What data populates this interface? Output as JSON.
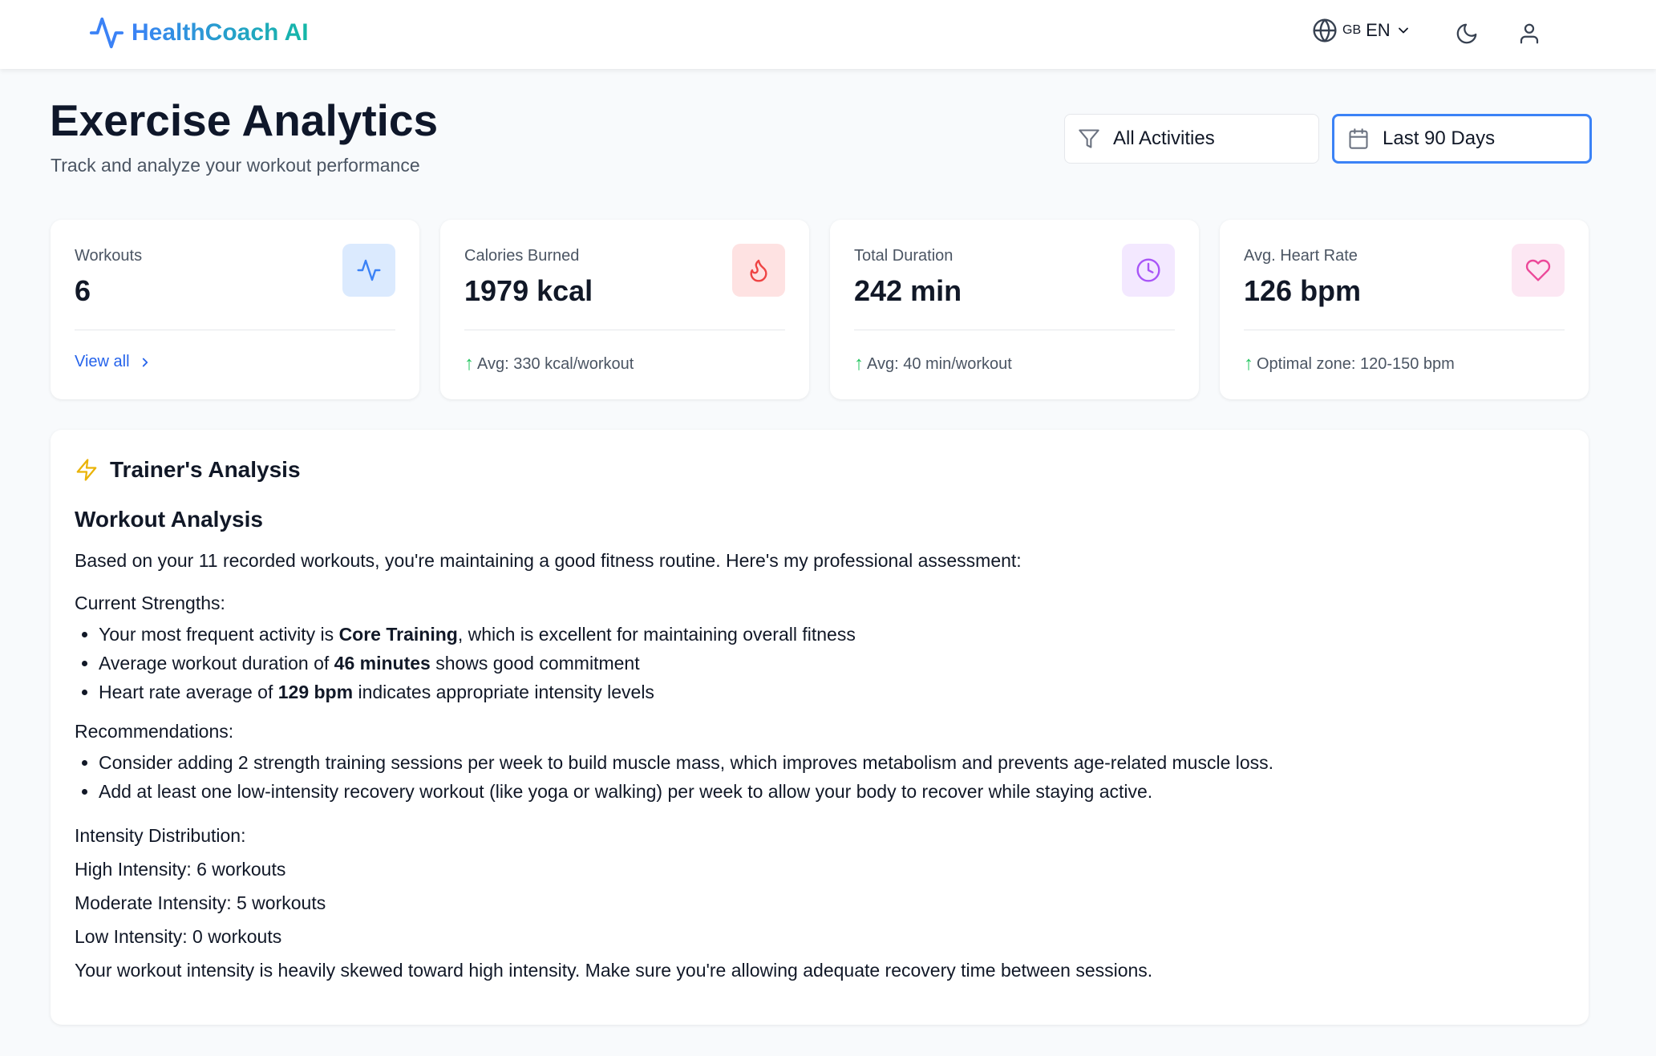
{
  "header": {
    "brand": "HealthCoach AI",
    "language": {
      "flag": "GB",
      "code": "EN"
    }
  },
  "page": {
    "title": "Exercise Analytics",
    "subtitle": "Track and analyze your workout performance"
  },
  "filters": {
    "activity": "All Activities",
    "range": "Last 90 Days"
  },
  "stats": [
    {
      "label": "Workouts",
      "value": "6",
      "footer": "View all",
      "icon": "activity-icon",
      "icon_bg": "#dbeafe",
      "icon_color": "#3b82f6"
    },
    {
      "label": "Calories Burned",
      "value": "1979 kcal",
      "footer": "Avg: 330 kcal/workout",
      "icon": "flame-icon",
      "icon_bg": "#fee2e2",
      "icon_color": "#ef4444"
    },
    {
      "label": "Total Duration",
      "value": "242 min",
      "footer": "Avg: 40 min/workout",
      "icon": "clock-icon",
      "icon_bg": "#f3e8ff",
      "icon_color": "#a855f7"
    },
    {
      "label": "Avg. Heart Rate",
      "value": "126 bpm",
      "footer": "Optimal zone: 120-150 bpm",
      "icon": "heart-icon",
      "icon_bg": "#fce7f3",
      "icon_color": "#ec4899"
    }
  ],
  "analysis": {
    "heading": "Trainer's Analysis",
    "title": "Workout Analysis",
    "intro": "Based on your 11 recorded workouts, you're maintaining a good fitness routine. Here's my professional assessment:",
    "strengths_heading": "Current Strengths:",
    "strengths": [
      {
        "pre": "Your most frequent activity is ",
        "bold": "Core Training",
        "post": ", which is excellent for maintaining overall fitness"
      },
      {
        "pre": "Average workout duration of ",
        "bold": "46 minutes",
        "post": " shows good commitment"
      },
      {
        "pre": "Heart rate average of ",
        "bold": "129 bpm",
        "post": " indicates appropriate intensity levels"
      }
    ],
    "recommendations_heading": "Recommendations:",
    "recommendations": [
      "Consider adding 2 strength training sessions per week to build muscle mass, which improves metabolism and prevents age-related muscle loss.",
      "Add at least one low-intensity recovery workout (like yoga or walking) per week to allow your body to recover while staying active."
    ],
    "intensity_heading": "Intensity Distribution:",
    "intensity": [
      "High Intensity: 6 workouts",
      "Moderate Intensity: 5 workouts",
      "Low Intensity: 0 workouts"
    ],
    "conclusion": "Your workout intensity is heavily skewed toward high intensity. Make sure you're allowing adequate recovery time between sessions."
  }
}
